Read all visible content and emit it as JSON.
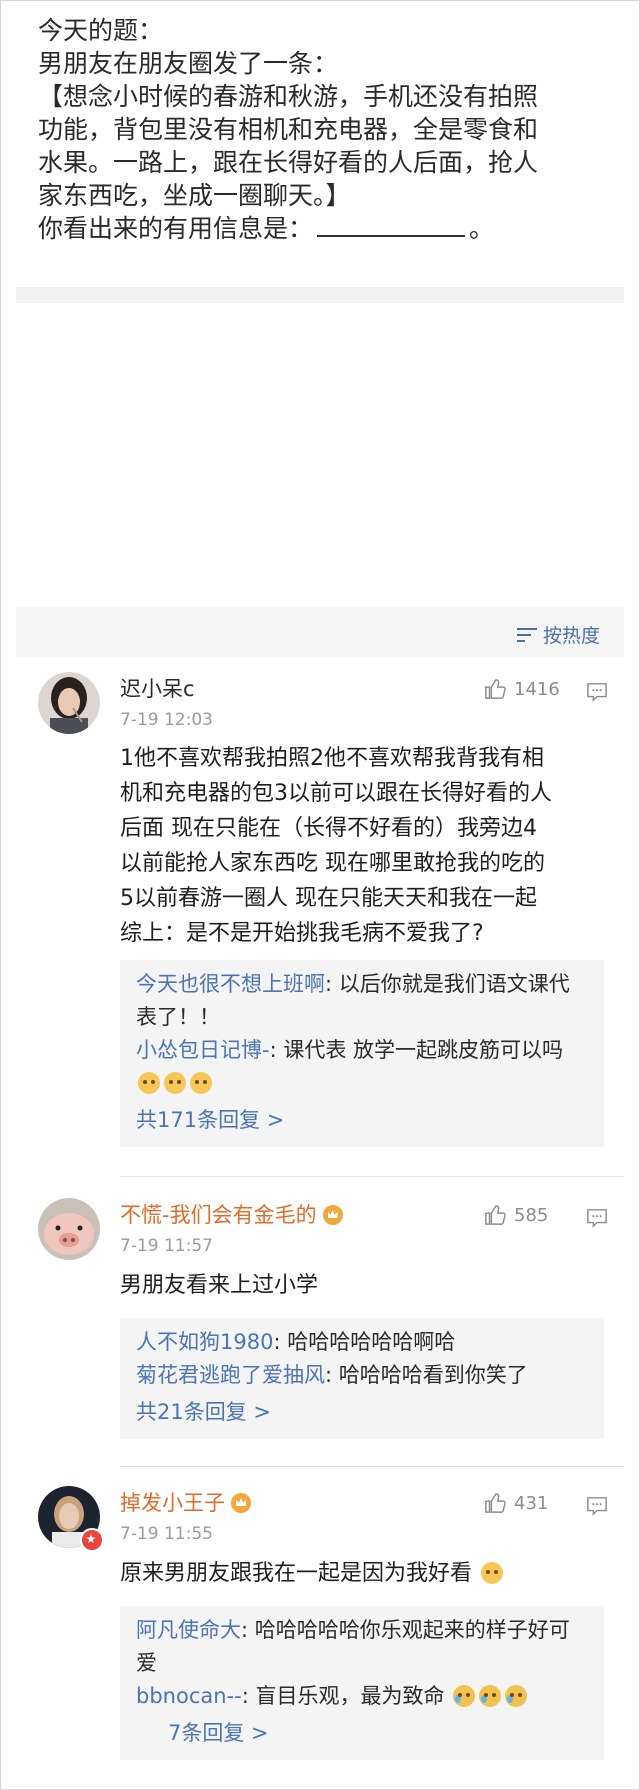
{
  "post": {
    "lines": [
      "今天的题：",
      "男朋友在朋友圈发了一条：",
      "【想念小时候的春游和秋游，手机还没有拍照",
      "功能，背包里没有相机和充电器，全是零食和",
      "水果。一路上，跟在长得好看的人后面，抢人",
      "家东西吃，坐成一圈聊天。】"
    ],
    "last_prefix": "你看出来的有用信息是：",
    "last_suffix": "。"
  },
  "sort": {
    "label": "按热度"
  },
  "comments": [
    {
      "user": "迟小呆c",
      "time": "7-19 12:03",
      "likes": "1416",
      "body": [
        "1他不喜欢帮我拍照2他不喜欢帮我背我有相",
        "机和充电器的包3以前可以跟在长得好看的人",
        "后面 现在只能在（长得不好看的）我旁边4",
        "以前能抢人家东西吃 现在哪里敢抢我的吃的",
        "5以前春游一圈人 现在只能天天和我在一起",
        "综上：是不是开始挑我毛病不爱我了?"
      ],
      "replies": [
        {
          "name": "今天也很不想上班啊",
          "text": ": 以后你就是我们语文课代表了！！"
        },
        {
          "name": "小怂包日记博-",
          "text": ": 课代表 放学一起跳皮筋可以吗"
        }
      ],
      "more": "共171条回复 >"
    },
    {
      "user": "不慌-我们会有金毛的",
      "time": "7-19 11:57",
      "likes": "585",
      "body": [
        "男朋友看来上过小学"
      ],
      "replies": [
        {
          "name": "人不如狗1980",
          "text": ": 哈哈哈哈哈哈啊哈"
        },
        {
          "name": "菊花君逃跑了爱抽风",
          "text": ": 哈哈哈哈看到你笑了"
        }
      ],
      "more": "共21条回复 >"
    },
    {
      "user": "掉发小王子",
      "time": "7-19 11:55",
      "likes": "431",
      "body": [
        "原来男朋友跟我在一起是因为我好看"
      ],
      "replies": [
        {
          "name": "阿凡使命大",
          "text": ": 哈哈哈哈哈你乐观起来的样子好可爱"
        },
        {
          "name": "bbnocan--",
          "text": ": 盲目乐观，最为致命"
        }
      ],
      "more": "7条回复 >"
    }
  ],
  "colors": {
    "link": "#4a74b5",
    "vip_name": "#e06b2a",
    "reply_bg": "#f4f4f4"
  }
}
